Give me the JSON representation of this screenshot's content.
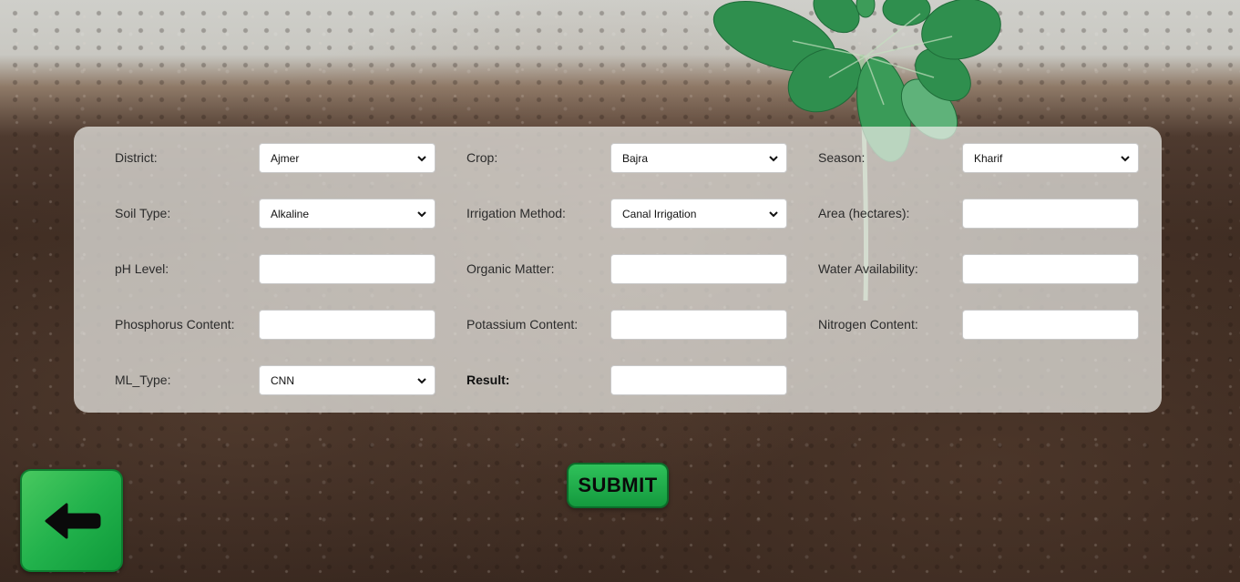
{
  "form": {
    "row1": {
      "district": {
        "label": "District:",
        "value": "Ajmer"
      },
      "crop": {
        "label": "Crop:",
        "value": "Bajra"
      },
      "season": {
        "label": "Season:",
        "value": "Kharif"
      }
    },
    "row2": {
      "soil_type": {
        "label": "Soil Type:",
        "value": "Alkaline"
      },
      "irrigation_method": {
        "label": "Irrigation Method:",
        "value": "Canal Irrigation"
      },
      "area": {
        "label": "Area (hectares):",
        "value": ""
      }
    },
    "row3": {
      "ph_level": {
        "label": "pH Level:",
        "value": ""
      },
      "organic_matter": {
        "label": "Organic Matter:",
        "value": ""
      },
      "water_availability": {
        "label": "Water Availability:",
        "value": ""
      }
    },
    "row4": {
      "phosphorus": {
        "label": "Phosphorus Content:",
        "value": ""
      },
      "potassium": {
        "label": "Potassium Content:",
        "value": ""
      },
      "nitrogen": {
        "label": "Nitrogen Content:",
        "value": ""
      }
    },
    "row5": {
      "ml_type": {
        "label": "ML_Type:",
        "value": "CNN"
      },
      "result": {
        "label": "Result:",
        "value": ""
      }
    }
  },
  "submit_label": "SUBMIT",
  "icons": {
    "back": "arrow-left-icon",
    "select": "chevron-down-icon"
  },
  "colors": {
    "button_green": "#1faa48",
    "panel": "#ebebe8"
  }
}
